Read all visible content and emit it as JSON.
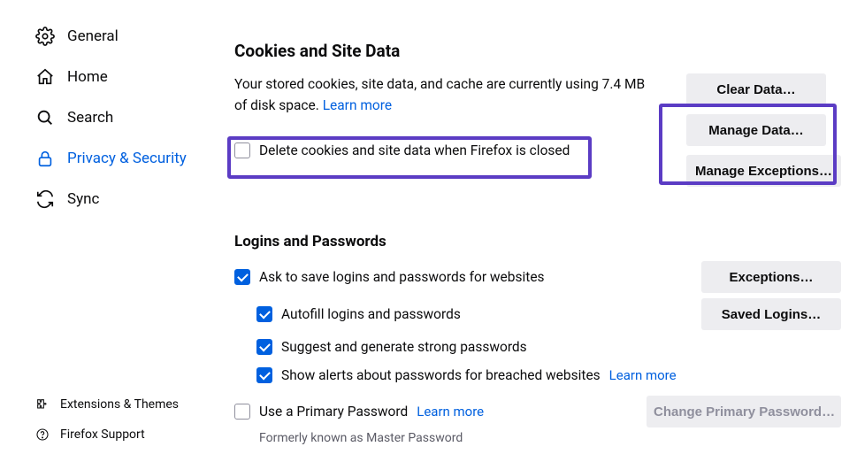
{
  "sidebar": {
    "items": [
      {
        "label": "General"
      },
      {
        "label": "Home"
      },
      {
        "label": "Search"
      },
      {
        "label": "Privacy & Security"
      },
      {
        "label": "Sync"
      }
    ],
    "footer": [
      {
        "label": "Extensions & Themes"
      },
      {
        "label": "Firefox Support"
      }
    ]
  },
  "cookies": {
    "header": "Cookies and Site Data",
    "descPrefix": "Your stored cookies, site data, and cache are currently using ",
    "storage": "7.4 MB",
    "descSuffix": " of disk space.  ",
    "learnMore": "Learn more",
    "deleteOnClose": "Delete cookies and site data when Firefox is closed",
    "buttons": {
      "clear": "Clear Data…",
      "manage": "Manage Data…",
      "exceptions": "Manage Exceptions…"
    }
  },
  "logins": {
    "header": "Logins and Passwords",
    "askSave": "Ask to save logins and passwords for websites",
    "autofill": "Autofill logins and passwords",
    "suggest": "Suggest and generate strong passwords",
    "alerts": "Show alerts about passwords for breached websites",
    "learnMore": "Learn more",
    "primary": "Use a Primary Password",
    "primaryLearn": "Learn more",
    "formerly": "Formerly known as Master Password",
    "buttons": {
      "exceptions": "Exceptions…",
      "saved": "Saved Logins…",
      "change": "Change Primary Password…"
    }
  }
}
